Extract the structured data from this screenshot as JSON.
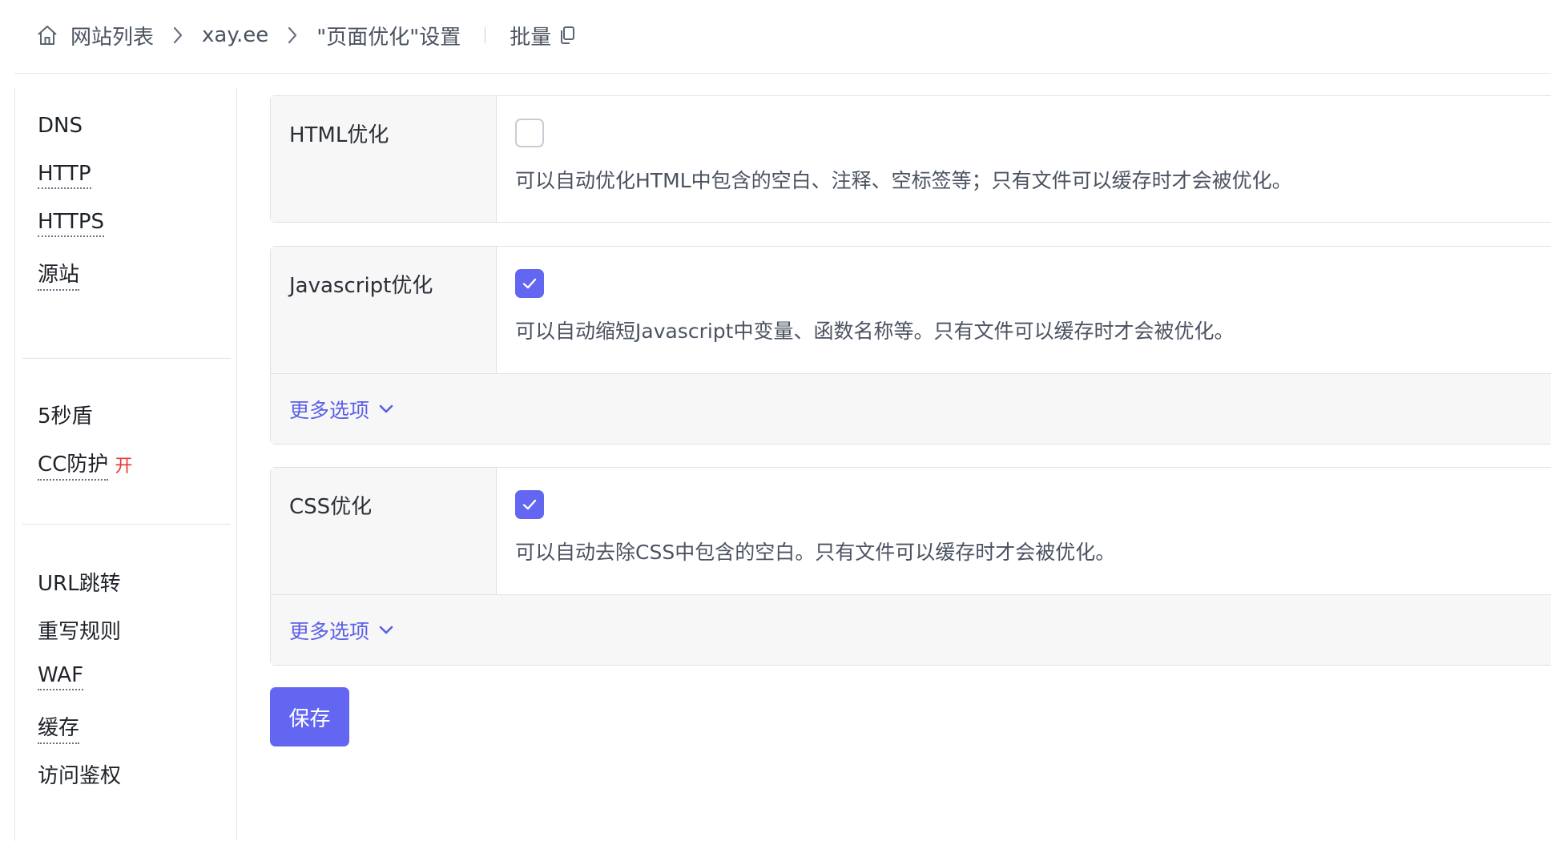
{
  "breadcrumb": {
    "home_icon": "home-icon",
    "items": [
      "网站列表",
      "xay.ee",
      "\"页面优化\"设置"
    ],
    "batch_label": "批量",
    "batch_icon": "copy-icon"
  },
  "sidebar": {
    "groups": [
      [
        {
          "label": "DNS",
          "dotted": false
        },
        {
          "label": "HTTP",
          "dotted": true
        },
        {
          "label": "HTTPS",
          "dotted": true
        },
        {
          "label": "源站",
          "dotted": true
        }
      ],
      [
        {
          "label": "5秒盾",
          "dotted": false
        },
        {
          "label": "CC防护",
          "dotted": true,
          "flag": "开"
        }
      ],
      [
        {
          "label": "URL跳转",
          "dotted": false
        },
        {
          "label": "重写规则",
          "dotted": false
        },
        {
          "label": "WAF",
          "dotted": true
        },
        {
          "label": "缓存",
          "dotted": true
        },
        {
          "label": "访问鉴权",
          "dotted": false
        }
      ]
    ]
  },
  "settings": [
    {
      "label": "HTML优化",
      "checked": false,
      "description": "可以自动优化HTML中包含的空白、注释、空标签等；只有文件可以缓存时才会被优化。"
    },
    {
      "label": "Javascript优化",
      "checked": true,
      "description": "可以自动缩短Javascript中变量、函数名称等。只有文件可以缓存时才会被优化。",
      "more_label": "更多选项"
    },
    {
      "label": "CSS优化",
      "checked": true,
      "description": "可以自动去除CSS中包含的空白。只有文件可以缓存时才会被优化。",
      "more_label": "更多选项"
    }
  ],
  "actions": {
    "save_label": "保存"
  },
  "colors": {
    "accent": "#6366f1",
    "link": "#5b5fe6",
    "flag": "#e53935"
  }
}
